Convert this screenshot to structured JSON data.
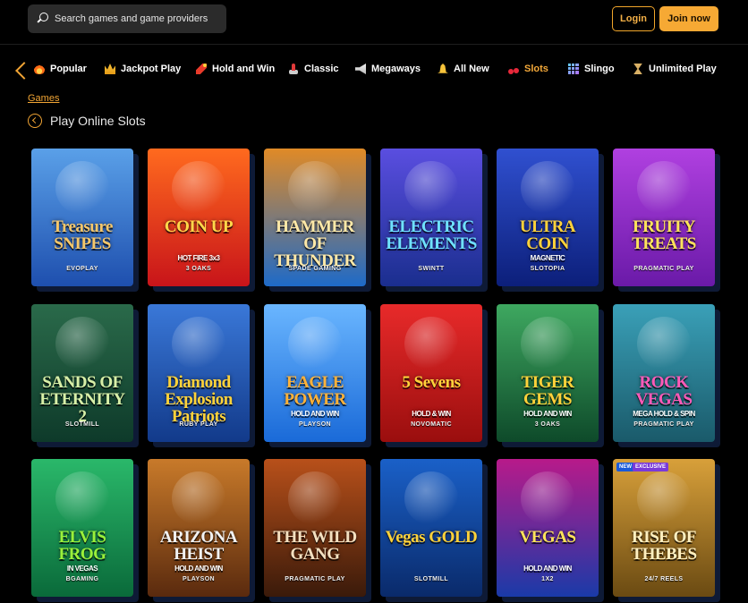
{
  "header": {
    "search_placeholder": "Search games and game providers",
    "login_label": "Login",
    "join_label": "Join now"
  },
  "categories": [
    {
      "label": "Popular",
      "icon": "fire-icon"
    },
    {
      "label": "Jackpot Play",
      "icon": "crown-icon"
    },
    {
      "label": "Hold and Win",
      "icon": "dynamite-icon"
    },
    {
      "label": "Classic",
      "icon": "joystick-icon"
    },
    {
      "label": "Megaways",
      "icon": "megaphone-icon"
    },
    {
      "label": "All New",
      "icon": "bell-icon"
    },
    {
      "label": "Slots",
      "icon": "cherry-icon",
      "active": true
    },
    {
      "label": "Slingo",
      "icon": "grid-icon"
    },
    {
      "label": "Unlimited Play",
      "icon": "hourglass-icon"
    }
  ],
  "breadcrumb": "Games",
  "page_title": "Play Online Slots",
  "games": [
    {
      "logo": "Treasure SNIPES",
      "provider": "EVOPLAY",
      "colors": [
        "#1e4fae",
        "#5aa0e8"
      ],
      "logo_color": "#f5c76a"
    },
    {
      "logo": "COIN UP",
      "sub": "HOT FIRE 3x3",
      "provider": "3 OAKS",
      "colors": [
        "#c8141a",
        "#ff6a1e"
      ],
      "logo_color": "#ffd84a"
    },
    {
      "logo": "HAMMER OF THUNDER",
      "provider": "SPADE GAMING",
      "colors": [
        "#1e6ac8",
        "#e08a26"
      ],
      "logo_color": "#ffe9a8"
    },
    {
      "logo": "ELECTRIC ELEMENTS",
      "provider": "SWINTT",
      "colors": [
        "#1a2e8e",
        "#5a4ee0"
      ],
      "logo_color": "#6fe2ff"
    },
    {
      "logo": "ULTRA COIN",
      "sub": "MAGNETIC",
      "provider": "SLOTOPIA",
      "colors": [
        "#0c1f7a",
        "#3050d0"
      ],
      "logo_color": "#ffd23a"
    },
    {
      "logo": "FRUITY TREATS",
      "provider": "PRAGMATIC PLAY",
      "colors": [
        "#6a1aa8",
        "#b040e0"
      ],
      "logo_color": "#ffe45a"
    },
    {
      "logo": "SANDS OF ETERNITY 2",
      "provider": "SLOTMILL",
      "colors": [
        "#0e3a2a",
        "#2a6a4a"
      ],
      "logo_color": "#d8f0a8"
    },
    {
      "logo": "Diamond Explosion Patriots",
      "provider": "RUBY PLAY",
      "colors": [
        "#123a8a",
        "#3a78d8"
      ],
      "logo_color": "#ffd23a"
    },
    {
      "logo": "EAGLE POWER",
      "sub": "HOLD AND WIN",
      "provider": "PLAYSON",
      "colors": [
        "#1a6ad8",
        "#6ab6ff"
      ],
      "logo_color": "#ffb23a"
    },
    {
      "logo": "5 Sevens",
      "sub": "HOLD & WIN",
      "provider": "NOVOMATIC",
      "colors": [
        "#9a0e0e",
        "#e82a2a"
      ],
      "logo_color": "#ffd23a"
    },
    {
      "logo": "TIGER GEMS",
      "sub": "HOLD AND WIN",
      "provider": "3 OAKS",
      "colors": [
        "#0e4a2a",
        "#3ea860"
      ],
      "logo_color": "#ffd23a"
    },
    {
      "logo": "ROCK VEGAS",
      "sub": "MEGA HOLD & SPIN",
      "provider": "PRAGMATIC PLAY",
      "colors": [
        "#1a5a6a",
        "#3aa0b8"
      ],
      "logo_color": "#ff5ab8"
    },
    {
      "logo": "ELVIS FROG",
      "sub": "IN VEGAS",
      "provider": "BGAMING",
      "colors": [
        "#0a6a3a",
        "#2ab86a"
      ],
      "logo_color": "#9af03a"
    },
    {
      "logo": "ARIZONA HEIST",
      "sub": "HOLD AND WIN",
      "provider": "PLAYSON",
      "colors": [
        "#5a2a0e",
        "#c87a2a"
      ],
      "logo_color": "#f2f2f2"
    },
    {
      "logo": "THE WILD GANG",
      "provider": "PRAGMATIC PLAY",
      "colors": [
        "#3a1a0a",
        "#b8501a"
      ],
      "logo_color": "#f4e0c0"
    },
    {
      "logo": "Vegas GOLD",
      "provider": "SLOTMILL",
      "colors": [
        "#0a2a6a",
        "#1a60c8"
      ],
      "logo_color": "#ffd23a"
    },
    {
      "logo": "VEGAS",
      "sub": "HOLD AND WIN",
      "provider": "1X2",
      "colors": [
        "#1a3aa8",
        "#b81a8a"
      ],
      "logo_color": "#ffe45a"
    },
    {
      "logo": "RISE OF THEBES",
      "provider": "24/7 REELS",
      "colors": [
        "#6a4a12",
        "#d8a03a"
      ],
      "logo_color": "#fff0c0",
      "badges": [
        "NEW",
        "EXCLUSIVE"
      ]
    }
  ],
  "colors": {
    "accent": "#f6a934",
    "background": "#000000",
    "search_bg": "#2b2b2b"
  }
}
